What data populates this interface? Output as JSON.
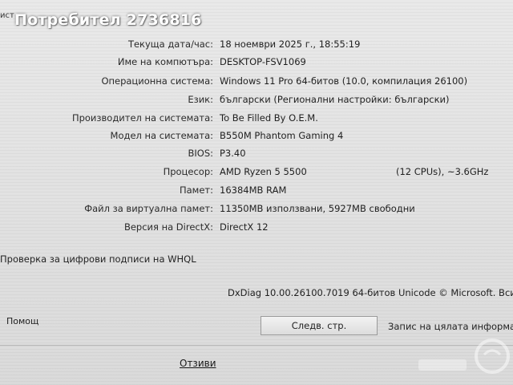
{
  "overlay": {
    "title": "Потребител 2736816"
  },
  "top_clip": "ист",
  "system_info": [
    {
      "label": "Текуща дата/час:",
      "value": "18 ноември 2025 г., 18:55:19"
    },
    {
      "label": "Име на компютъра:",
      "value": "DESKTOP-FSV1069"
    },
    {
      "label": "Операционна система:",
      "value": "Windows 11 Pro 64-битов (10.0, компилация 26100)"
    },
    {
      "label": "Език:",
      "value": "български (Регионални настройки: български)"
    },
    {
      "label": "Производител на системата:",
      "value": "To Be Filled By O.E.M."
    },
    {
      "label": "Модел на системата:",
      "value": "B550M Phantom Gaming 4"
    },
    {
      "label": "BIOS:",
      "value": "P3.40"
    },
    {
      "label": "Процесор:",
      "value": "AMD Ryzen 5 5500",
      "extra": "(12 CPUs), ~3.6GHz"
    },
    {
      "label": "Памет:",
      "value": "16384MB RAM"
    },
    {
      "label": "Файл за виртуална памет:",
      "value": "11350MB използвани, 5927MB свободни"
    },
    {
      "label": "Версия на DirectX:",
      "value": "DirectX 12"
    }
  ],
  "whql_check": "Проверка за цифрови подписи на WHQL",
  "dxdiag_version": "DxDiag 10.00.26100.7019 64-битов Unicode © Microsoft. Вси",
  "buttons": {
    "help": "Помощ",
    "next_page": "Следв. стр.",
    "save_all": "Запис на цялата информа"
  },
  "reviews_link": "Отзиви",
  "colors": {
    "background": "#e6e6e6",
    "text": "#222222",
    "overlay_text": "#ffffff"
  },
  "icons": {
    "watermark": "bazar-logo"
  }
}
